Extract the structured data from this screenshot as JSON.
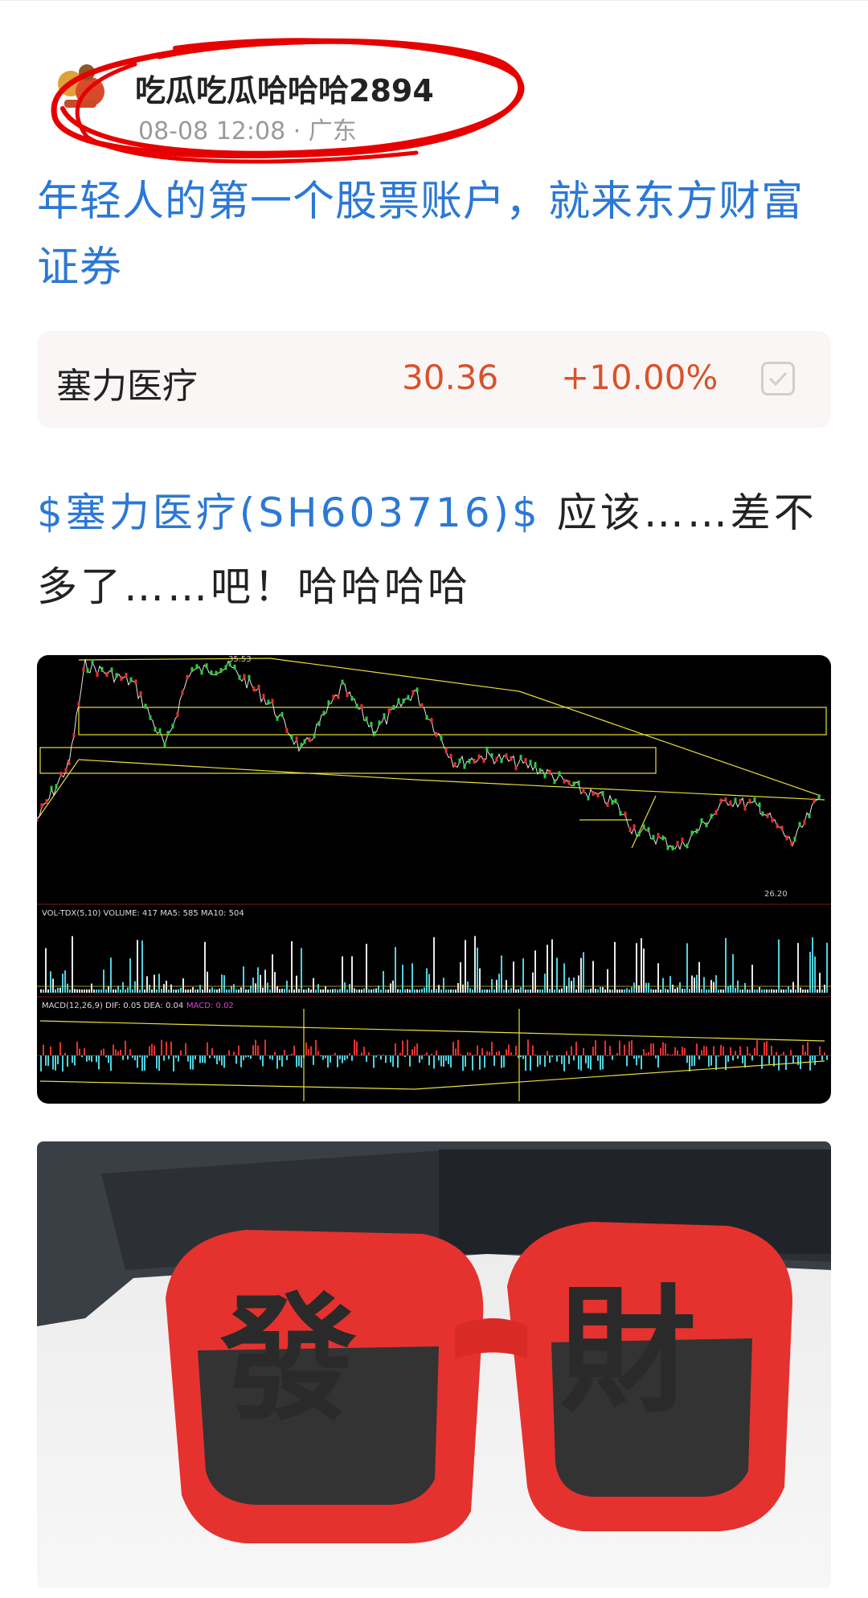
{
  "post": {
    "username": "吃瓜吃瓜哈哈哈2894",
    "meta": "08-08 12:08 · 广东",
    "ad_link": "年轻人的第一个股票账户，就来东方财富证券"
  },
  "stock_card": {
    "name": "塞力医疗",
    "price": "30.36",
    "change": "+10.00%"
  },
  "body": {
    "tag": "$塞力医疗(SH603716)$",
    "text": " 应该……差不多了……吧！哈哈哈哈"
  },
  "chart_image": {
    "high_label": "35.53",
    "low_label": "26.20",
    "vol_label": "VOL-TDX(5,10)  VOLUME: 417  MA5: 585  MA10: 504",
    "macd_label": "MACD(12,26,9)  DIF: 0.05  DEA: 0.04",
    "macd_value": "MACD: 0.02"
  },
  "colors": {
    "link": "#2b78d6",
    "up": "#d9522b",
    "annotation": "#e60000",
    "trendline": "#e8e03a"
  }
}
